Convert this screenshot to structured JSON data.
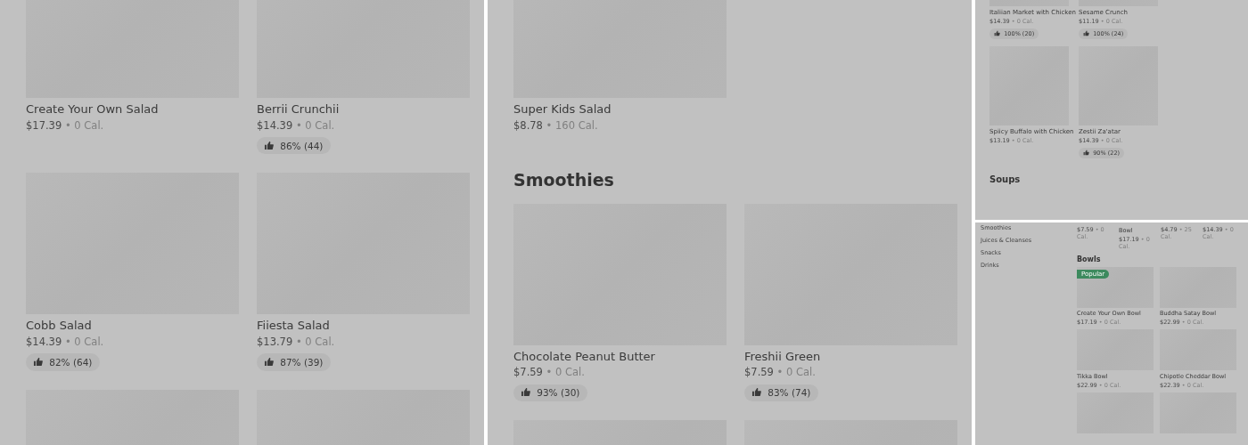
{
  "separator": "•",
  "panels": [
    {
      "kind": "large",
      "blocks": [
        {
          "kind": "row",
          "cards": [
            {
              "kind": "item",
              "name": "Create Your Own Salad",
              "price": "$17.39",
              "calories": "0 Cal."
            },
            {
              "kind": "item",
              "name": "Berrii Crunchii",
              "price": "$14.39",
              "calories": "0 Cal.",
              "rating": "86% (44)"
            }
          ]
        },
        {
          "kind": "row",
          "cards": [
            {
              "kind": "item",
              "name": "Cobb Salad",
              "price": "$14.39",
              "calories": "0 Cal.",
              "rating": "82% (64)"
            },
            {
              "kind": "item",
              "name": "Fiiesta Salad",
              "price": "$13.79",
              "calories": "0 Cal.",
              "rating": "87% (39)"
            }
          ]
        },
        {
          "kind": "row"
        }
      ]
    },
    {
      "kind": "large",
      "blocks": [
        {
          "kind": "row",
          "cards": [
            {
              "kind": "item",
              "name": "Super Kids Salad",
              "price": "$8.78",
              "calories": "160 Cal."
            }
          ]
        },
        {
          "kind": "heading",
          "text": "Smoothies"
        },
        {
          "kind": "row",
          "cards": [
            {
              "kind": "item",
              "name": "Chocolate Peanut Butter",
              "price": "$7.59",
              "calories": "0 Cal.",
              "rating": "93% (30)"
            },
            {
              "kind": "item",
              "name": "Freshii Green",
              "price": "$7.59",
              "calories": "0 Cal.",
              "rating": "83% (74)"
            }
          ]
        },
        {
          "kind": "row"
        }
      ]
    },
    {
      "kind": "small",
      "blocks": [
        {
          "kind": "row",
          "cards": [
            {
              "kind": "item",
              "name": "Italiian Market with Chicken",
              "price": "$14.39",
              "calories": "0 Cal.",
              "rating": "100% (20)"
            },
            {
              "kind": "item",
              "name": "Sesame Crunch",
              "price": "$11.19",
              "calories": "0 Cal.",
              "rating": "100% (24)"
            }
          ]
        },
        {
          "kind": "row",
          "cards": [
            {
              "kind": "item",
              "name": "Spiicy Buffalo with Chicken",
              "price": "$13.19",
              "calories": "0 Cal."
            },
            {
              "kind": "item",
              "name": "Zestii Za'atar",
              "price": "$14.39",
              "calories": "0 Cal.",
              "rating": "90% (22)"
            }
          ]
        },
        {
          "kind": "heading",
          "text": "Soups"
        }
      ]
    },
    {
      "kind": "menu",
      "sidebar": [
        "Smoothies",
        "Juices & Cleanses",
        "Snacks",
        "Drinks"
      ],
      "blocks": [
        {
          "kind": "strip",
          "cards": [
            {
              "kind": "item",
              "price": "$7.59",
              "calories": "0 Cal."
            },
            {
              "kind": "item",
              "name": "Bowl",
              "price": "$17.19",
              "calories": "0 Cal."
            },
            {
              "kind": "item",
              "price": "$4.79",
              "calories": "25 Cal."
            },
            {
              "kind": "item",
              "price": "$14.39",
              "calories": "0 Cal."
            }
          ]
        },
        {
          "kind": "heading",
          "text": "Bowls"
        },
        {
          "kind": "row",
          "cards": [
            {
              "kind": "item",
              "name": "Create Your Own Bowl",
              "price": "$17.19",
              "calories": "0 Cal.",
              "badge": "Popular"
            },
            {
              "kind": "item",
              "name": "Buddha Satay Bowl",
              "price": "$22.99",
              "calories": "0 Cal."
            }
          ]
        },
        {
          "kind": "row",
          "cards": [
            {
              "kind": "item",
              "name": "Tikka Bowl",
              "price": "$22.99",
              "calories": "0 Cal."
            },
            {
              "kind": "item",
              "name": "Chipotle Cheddar Bowl",
              "price": "$22.39",
              "calories": "0 Cal."
            }
          ]
        },
        {
          "kind": "row"
        }
      ]
    }
  ]
}
